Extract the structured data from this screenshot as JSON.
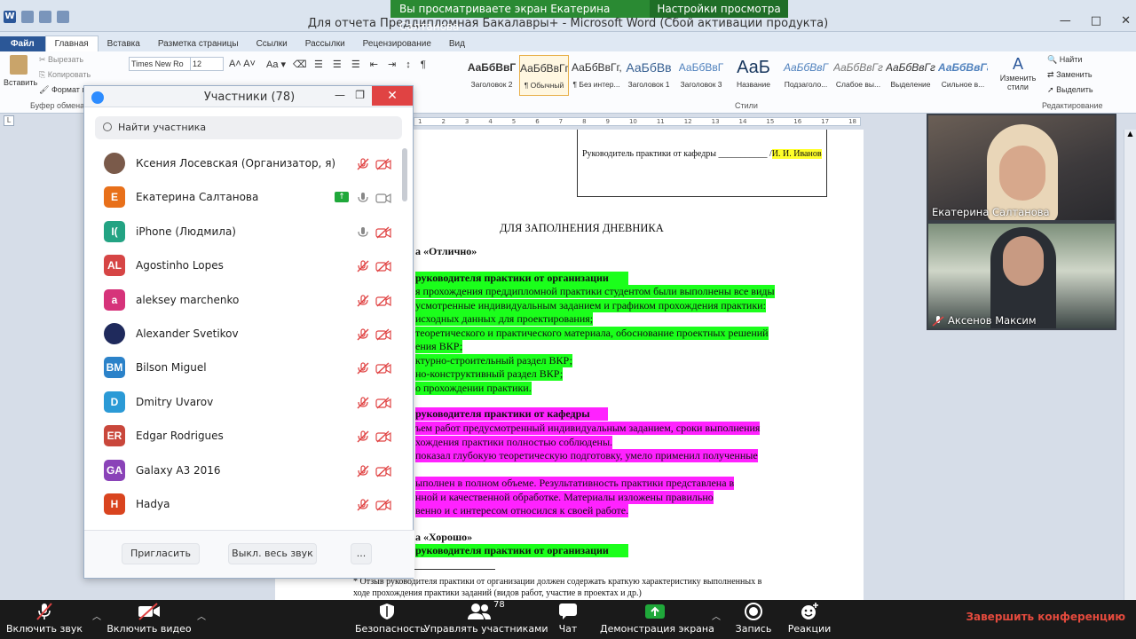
{
  "share_banner": {
    "viewing_text": "Вы просматриваете экран Екатерина Салтанова",
    "view_options": "Настройки просмотра"
  },
  "window": {
    "title": "Для отчета Преддипломная  Бакалавры+  -  Microsoft Word (Сбой активации продукта)",
    "min": "—",
    "max": "□",
    "close": "✕"
  },
  "ribbon_tabs": [
    "Файл",
    "Главная",
    "Вставка",
    "Разметка страницы",
    "Ссылки",
    "Рассылки",
    "Рецензирование",
    "Вид"
  ],
  "ribbon": {
    "paste": "Вставить",
    "cut": "Вырезать",
    "copy": "Копировать",
    "format": "Формат п",
    "clipboard_group": "Буфер обмена",
    "font_name": "Times New Ro",
    "font_size": "12",
    "styles": [
      {
        "preview": "АаБбВвГ",
        "name": "Заголовок 2"
      },
      {
        "preview": "АаБбВвГг,",
        "name": "¶ Обычный"
      },
      {
        "preview": "АаБбВвГг,",
        "name": "¶ Без интер..."
      },
      {
        "preview": "АаБбВв",
        "name": "Заголовок 1"
      },
      {
        "preview": "АаБбВвГ",
        "name": "Заголовок 3"
      },
      {
        "preview": "АаБ",
        "name": "Название"
      },
      {
        "preview": "АаБбВвГ",
        "name": "Подзаголо..."
      },
      {
        "preview": "АаБбВвГг,",
        "name": "Слабое вы..."
      },
      {
        "preview": "АаБбВвГг,",
        "name": "Выделение"
      },
      {
        "preview": "АаБбВвГг",
        "name": "Сильное в..."
      }
    ],
    "styles_group": "Стили",
    "change_styles": "Изменить стили",
    "find": "Найти",
    "replace": "Заменить",
    "select": "Выделить",
    "editing_group": "Редактирование"
  },
  "ruler_marks": [
    "1",
    "2",
    "3",
    "4",
    "5",
    "6",
    "7",
    "8",
    "9",
    "10",
    "11",
    "12",
    "13",
    "14",
    "15",
    "16",
    "17",
    "18"
  ],
  "document": {
    "supervisor_line": "Руководитель практики от кафедры ___________ /",
    "supervisor_name": "И. И. Иванов",
    "heading": "ДЛЯ ЗАПОЛНЕНИЯ ДНЕВНИКА",
    "grade_excellent": "а «Отлично»",
    "org_head_1": "руководителя практики от организации",
    "org_lines": [
      "я прохождения преддипломной практики студентом  были выполнены все виды",
      "усмотренные   индивидуальным заданием и графиком прохождения практики:",
      "исходных данных для проектирования;",
      "теоретического и практического материала, обоснование проектных решений",
      "ения ВКР;",
      "ктурно-строительный раздел ВКР;",
      "но-конструктивный раздел ВКР;",
      "о прохождении практики."
    ],
    "dept_head": "руководителя практики от кафедры",
    "dept_lines": [
      "ъем работ предусмотренный индивидуальным заданием, сроки выполнения",
      "хождения практики  полностью соблюдены.",
      " показал глубокую теоретическую подготовку, умело применил полученные",
      "",
      "ыполнен в полном объеме. Результативность практики представлена в",
      "нной и качественной обработке. Материалы изложены правильно",
      "венно и  с интересом относился к своей работе."
    ],
    "grade_good": "а «Хорошо»",
    "org_head_2": "руководителя практики от организации",
    "footnote_1": "* Отзыв руководителя практики от организации должен содержать краткую характеристику выполненных в",
    "footnote_2": "ходе прохождения практики заданий (видов работ, участие в проектах и др.)"
  },
  "participants_panel": {
    "title": "Участники (78)",
    "search_placeholder": "Найти участника",
    "participants": [
      {
        "initials": "",
        "name": "Ксения Лосевская (Организатор, я)",
        "color": "#7a5a4a",
        "mic": "muted",
        "cam": "off"
      },
      {
        "initials": "Е",
        "name": "Екатерина Салтанова",
        "color": "#e8701a",
        "mic": "on",
        "cam": "on",
        "sharing": true
      },
      {
        "initials": "I(",
        "name": "iPhone (Людмила)",
        "color": "#23a383",
        "mic": "on",
        "cam": "off"
      },
      {
        "initials": "AL",
        "name": "Agostinho Lopes",
        "color": "#d64545",
        "mic": "muted",
        "cam": "off"
      },
      {
        "initials": "a",
        "name": "aleksey marchenko",
        "color": "#d6337a",
        "mic": "muted",
        "cam": "off"
      },
      {
        "initials": "",
        "name": "Alexander Svetikov",
        "color": "#1f2a5c",
        "mic": "muted",
        "cam": "off"
      },
      {
        "initials": "BM",
        "name": "Bilson Miguel",
        "color": "#2b82c9",
        "mic": "muted",
        "cam": "off"
      },
      {
        "initials": "D",
        "name": "Dmitry Uvarov",
        "color": "#2b9ad6",
        "mic": "muted",
        "cam": "off"
      },
      {
        "initials": "ER",
        "name": "Edgar Rodrigues",
        "color": "#c9473b",
        "mic": "muted",
        "cam": "off"
      },
      {
        "initials": "GA",
        "name": "Galaxy A3 2016",
        "color": "#8a43b8",
        "mic": "muted",
        "cam": "off"
      },
      {
        "initials": "H",
        "name": "Hadya",
        "color": "#d9441f",
        "mic": "muted",
        "cam": "off"
      }
    ],
    "invite": "Пригласить",
    "mute_all": "Выкл. весь звук",
    "more": "..."
  },
  "video_tiles": [
    {
      "name": "Екатерина Салтанова",
      "muted": false
    },
    {
      "name": "Аксенов Максим",
      "muted": true
    }
  ],
  "zoom_toolbar": {
    "unmute": "Включить звук",
    "start_video": "Включить видео",
    "security": "Безопасность",
    "manage_participants": "Управлять участниками",
    "participant_count": "78",
    "chat": "Чат",
    "share_screen": "Демонстрация экрана",
    "record": "Запись",
    "reactions": "Реакции",
    "end": "Завершить конференцию",
    "colors": {
      "end": "#e44a3d",
      "share": "#1fa83a"
    }
  }
}
